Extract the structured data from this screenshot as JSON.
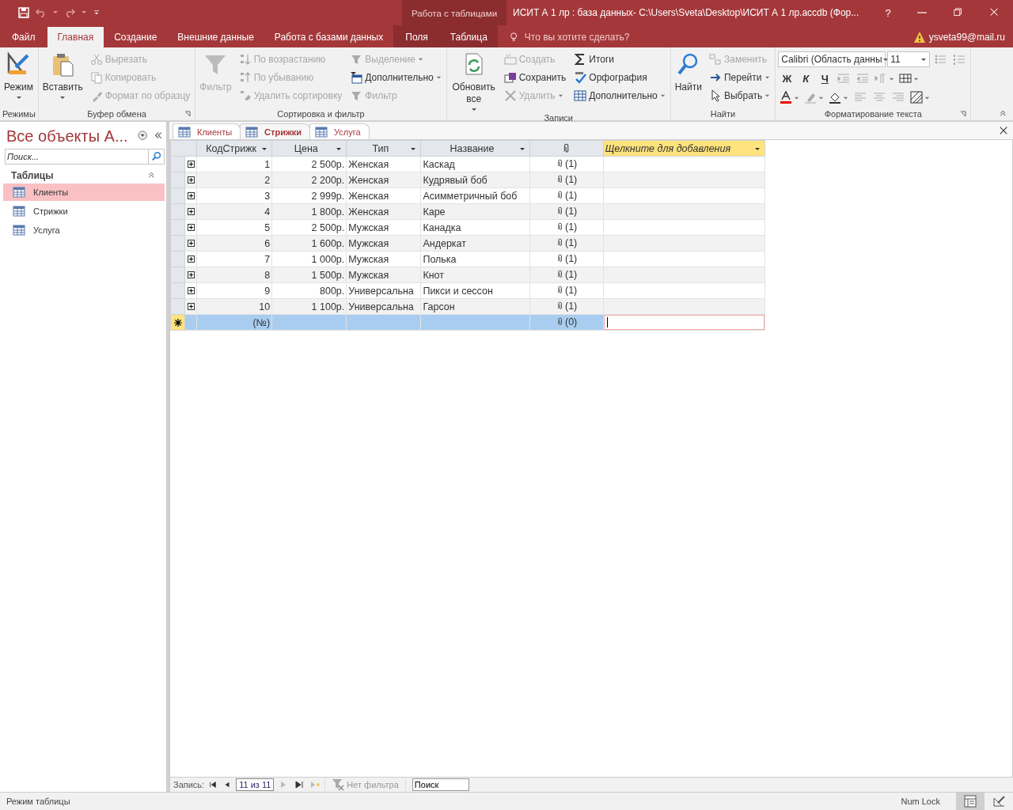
{
  "title_bar": {
    "contextual_label": "Работа с таблицами",
    "title": "ИСИТ А 1 лр : база данных- C:\\Users\\Sveta\\Desktop\\ИСИТ А 1 лр.accdb (Фор...",
    "help": "?"
  },
  "ribbon_tabs": [
    {
      "label": "Файл",
      "selected": false,
      "contextual": false
    },
    {
      "label": "Главная",
      "selected": true,
      "contextual": false
    },
    {
      "label": "Создание",
      "selected": false,
      "contextual": false
    },
    {
      "label": "Внешние данные",
      "selected": false,
      "contextual": false
    },
    {
      "label": "Работа с базами данных",
      "selected": false,
      "contextual": false
    },
    {
      "label": "Поля",
      "selected": false,
      "contextual": true
    },
    {
      "label": "Таблица",
      "selected": false,
      "contextual": true
    }
  ],
  "tell_me": {
    "placeholder": "Что вы хотите сделать?"
  },
  "account": {
    "name": "ysveta99@mail.ru"
  },
  "ribbon_groups": [
    {
      "label": "Режимы",
      "launcher": false,
      "columns": [
        [
          {
            "kind": "large",
            "label": "Режим",
            "disabled": false,
            "dropdown": true
          }
        ]
      ]
    },
    {
      "label": "Буфер обмена",
      "launcher": true,
      "columns": [
        [
          {
            "kind": "large",
            "label": "Вставить",
            "disabled": false,
            "dropdown": true
          }
        ],
        [
          {
            "kind": "small",
            "label": "Вырезать",
            "disabled": true,
            "dropdown": false
          },
          {
            "kind": "small",
            "label": "Копировать",
            "disabled": true,
            "dropdown": false
          },
          {
            "kind": "small",
            "label": "Формат по образцу",
            "disabled": true,
            "dropdown": false
          }
        ]
      ]
    },
    {
      "label": "Сортировка и фильтр",
      "launcher": false,
      "columns": [
        [
          {
            "kind": "large",
            "label": "Фильтр",
            "disabled": true,
            "dropdown": false
          }
        ],
        [
          {
            "kind": "small",
            "label": "По возрастанию",
            "disabled": true,
            "dropdown": false
          },
          {
            "kind": "small",
            "label": "По убыванию",
            "disabled": true,
            "dropdown": false
          },
          {
            "kind": "small",
            "label": "Удалить сортировку",
            "disabled": true,
            "dropdown": false
          }
        ],
        [
          {
            "kind": "small",
            "label": "Выделение",
            "disabled": true,
            "dropdown": true
          },
          {
            "kind": "small",
            "label": "Дополнительно",
            "disabled": false,
            "dropdown": true
          },
          {
            "kind": "small",
            "label": "Фильтр",
            "disabled": true,
            "dropdown": false
          }
        ]
      ]
    },
    {
      "label": "Записи",
      "launcher": false,
      "columns": [
        [
          {
            "kind": "large",
            "label": "Обновить все",
            "disabled": false,
            "dropdown": true
          }
        ],
        [
          {
            "kind": "small",
            "label": "Создать",
            "disabled": true,
            "dropdown": false
          },
          {
            "kind": "small",
            "label": "Сохранить",
            "disabled": false,
            "dropdown": false
          },
          {
            "kind": "small",
            "label": "Удалить",
            "disabled": true,
            "dropdown": true
          }
        ],
        [
          {
            "kind": "small",
            "label": "Итоги",
            "disabled": false,
            "dropdown": false
          },
          {
            "kind": "small",
            "label": "Орфография",
            "disabled": false,
            "dropdown": false
          },
          {
            "kind": "small",
            "label": "Дополнительно",
            "disabled": false,
            "dropdown": true
          }
        ]
      ]
    },
    {
      "label": "Найти",
      "launcher": false,
      "columns": [
        [
          {
            "kind": "large",
            "label": "Найти",
            "disabled": false,
            "dropdown": false
          }
        ],
        [
          {
            "kind": "small",
            "label": "Заменить",
            "disabled": true,
            "dropdown": false
          },
          {
            "kind": "small",
            "label": "Перейти",
            "disabled": false,
            "dropdown": true
          },
          {
            "kind": "small",
            "label": "Выбрать",
            "disabled": false,
            "dropdown": true
          }
        ]
      ]
    }
  ],
  "text_format": {
    "label": "Форматирование текста",
    "launcher": true,
    "font": "Calibri (Область данны",
    "size": "11",
    "rows": [
      [
        {
          "kind": "icon",
          "disabled": true,
          "dropdown": false
        },
        {
          "kind": "icon",
          "disabled": true,
          "dropdown": false
        }
      ],
      [
        {
          "kind": "text",
          "label": "Ж",
          "disabled": false
        },
        {
          "kind": "text",
          "label": "К",
          "disabled": false
        },
        {
          "kind": "text",
          "label": "Ч",
          "disabled": false
        },
        {
          "kind": "icon",
          "disabled": true,
          "dropdown": false
        },
        {
          "kind": "icon",
          "disabled": true,
          "dropdown": false
        },
        {
          "kind": "icon",
          "disabled": true,
          "dropdown": true
        },
        {
          "kind": "icon",
          "disabled": false,
          "dropdown": true
        }
      ],
      [
        {
          "kind": "icon",
          "disabled": false,
          "dropdown": true
        },
        {
          "kind": "icon",
          "disabled": true,
          "dropdown": true
        },
        {
          "kind": "icon",
          "disabled": false,
          "dropdown": true
        },
        {
          "kind": "icon",
          "disabled": true,
          "dropdown": false
        },
        {
          "kind": "icon",
          "disabled": true,
          "dropdown": false
        },
        {
          "kind": "icon",
          "disabled": true,
          "dropdown": false
        },
        {
          "kind": "icon",
          "disabled": false,
          "dropdown": true
        }
      ]
    ]
  },
  "nav_pane": {
    "title": "Все объекты А...",
    "search": {
      "placeholder": "Поиск..."
    },
    "section": "Таблицы",
    "items": [
      {
        "label": "Клиенты",
        "selected": true
      },
      {
        "label": "Стрижки",
        "selected": false
      },
      {
        "label": "Услуга",
        "selected": false
      }
    ]
  },
  "doc_tabs": [
    {
      "label": "Клиенты",
      "selected": false
    },
    {
      "label": "Стрижки",
      "selected": true
    },
    {
      "label": "Услуга",
      "selected": false
    }
  ],
  "table": {
    "columns": [
      {
        "label": "КодСтрижк",
        "kind": "number"
      },
      {
        "label": "Цена",
        "kind": "number"
      },
      {
        "label": "Тип",
        "kind": "text"
      },
      {
        "label": "Название",
        "kind": "text"
      },
      {
        "kind": "attachment"
      },
      {
        "label": "Щелкните для добавления",
        "kind": "add"
      }
    ],
    "rows": [
      {
        "new": false,
        "cells": [
          "1",
          "2 500р.",
          "Женская",
          "Каскад",
          "(1)"
        ]
      },
      {
        "new": false,
        "cells": [
          "2",
          "2 200р.",
          "Женская",
          "Кудрявый боб",
          "(1)"
        ]
      },
      {
        "new": false,
        "cells": [
          "3",
          "2 999р.",
          "Женская",
          "Асимметричный боб",
          "(1)"
        ]
      },
      {
        "new": false,
        "cells": [
          "4",
          "1 800р.",
          "Женская",
          "Каре",
          "(1)"
        ]
      },
      {
        "new": false,
        "cells": [
          "5",
          "2 500р.",
          "Мужская",
          "Канадка",
          "(1)"
        ]
      },
      {
        "new": false,
        "cells": [
          "6",
          "1 600р.",
          "Мужская",
          "Андеркат",
          "(1)"
        ]
      },
      {
        "new": false,
        "cells": [
          "7",
          "1 000р.",
          "Мужская",
          "Полька",
          "(1)"
        ]
      },
      {
        "new": false,
        "cells": [
          "8",
          "1 500р.",
          "Мужская",
          "Кнот",
          "(1)"
        ]
      },
      {
        "new": false,
        "cells": [
          "9",
          "800р.",
          "Универсальна",
          "Пикси и сессон",
          "(1)"
        ]
      },
      {
        "new": false,
        "cells": [
          "10",
          "1 100р.",
          "Универсальна",
          "Гарсон",
          "(1)"
        ]
      },
      {
        "new": true,
        "cells": [
          "(№)",
          "",
          "",
          "",
          "(0)"
        ]
      }
    ]
  },
  "record_nav": {
    "label": "Запись:",
    "position": "11 из 11",
    "filter": "Нет фильтра",
    "search": {
      "placeholder": "Поиск"
    }
  },
  "status_bar": {
    "mode": "Режим таблицы",
    "num_lock": "Num Lock",
    "views": [
      {
        "selected": true
      },
      {
        "selected": false
      }
    ]
  }
}
